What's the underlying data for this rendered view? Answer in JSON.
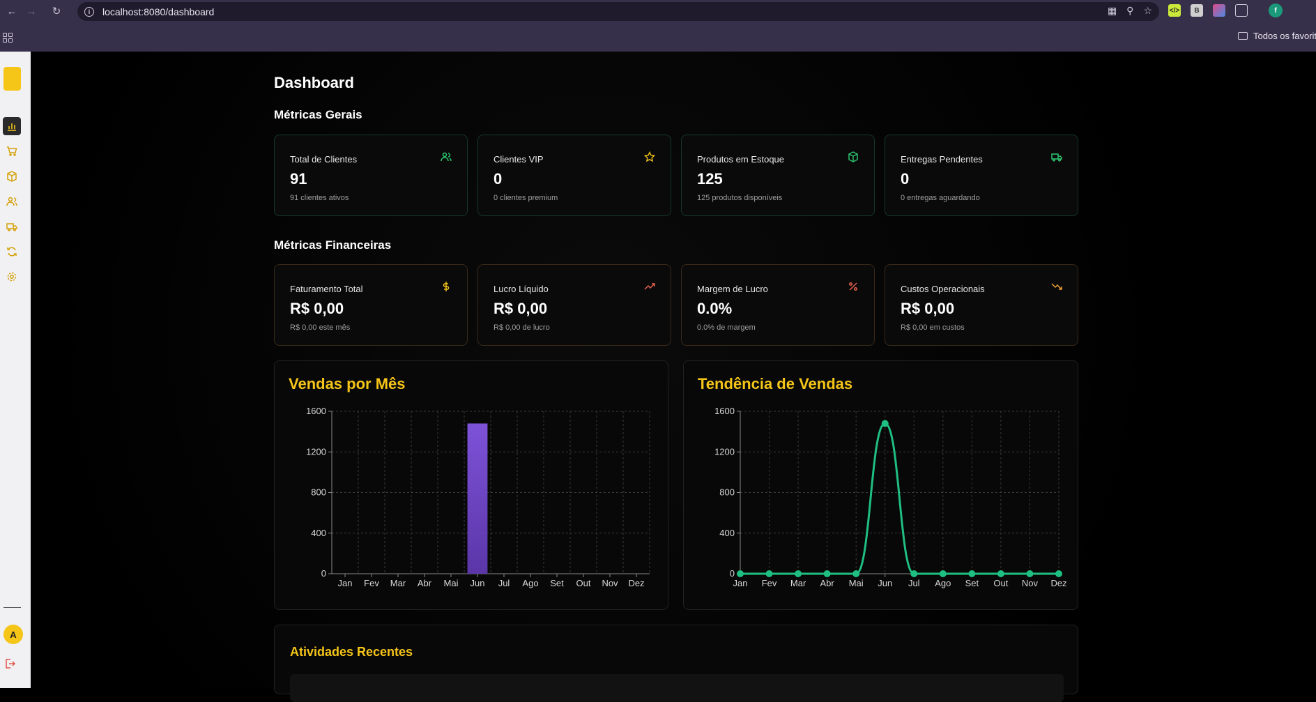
{
  "browser": {
    "url": "localhost:8080/dashboard",
    "bookmarks_label": "Todos os favoritos",
    "profile_initial": "f"
  },
  "sidebar": {
    "items": [
      {
        "name": "dashboard",
        "icon": "bar-chart-icon",
        "active": true
      },
      {
        "name": "sales",
        "icon": "cart-icon",
        "active": false
      },
      {
        "name": "products",
        "icon": "box-icon",
        "active": false
      },
      {
        "name": "clients",
        "icon": "users-icon",
        "active": false
      },
      {
        "name": "deliveries",
        "icon": "truck-icon",
        "active": false
      },
      {
        "name": "sync",
        "icon": "refresh-icon",
        "active": false
      },
      {
        "name": "settings",
        "icon": "gear-icon",
        "active": false
      }
    ],
    "avatar_initial": "A"
  },
  "page": {
    "title": "Dashboard",
    "general_title": "Métricas Gerais",
    "financial_title": "Métricas Financeiras",
    "recent_title": "Atividades Recentes"
  },
  "general_cards": [
    {
      "label": "Total de Clientes",
      "value": "91",
      "sub": "91 clientes ativos",
      "icon": "users-icon"
    },
    {
      "label": "Clientes VIP",
      "value": "0",
      "sub": "0 clientes premium",
      "icon": "star-icon"
    },
    {
      "label": "Produtos em Estoque",
      "value": "125",
      "sub": "125 produtos disponíveis",
      "icon": "box-icon"
    },
    {
      "label": "Entregas Pendentes",
      "value": "0",
      "sub": "0 entregas aguardando",
      "icon": "truck-icon"
    }
  ],
  "financial_cards": [
    {
      "label": "Faturamento Total",
      "value": "R$ 0,00",
      "sub": "R$ 0,00 este mês",
      "icon": "dollar-icon"
    },
    {
      "label": "Lucro Líquido",
      "value": "R$ 0,00",
      "sub": "R$ 0,00 de lucro",
      "icon": "trending-up-icon"
    },
    {
      "label": "Margem de Lucro",
      "value": "0.0%",
      "sub": "0.0% de margem",
      "icon": "percent-icon"
    },
    {
      "label": "Custos Operacionais",
      "value": "R$ 0,00",
      "sub": "R$ 0,00 em custos",
      "icon": "trending-down-icon"
    }
  ],
  "colors": {
    "accent": "#f5c518",
    "bar": "#7b4fd6",
    "line": "#1fbf82",
    "green_icon": "#2ecc71",
    "orange_icon": "#f0a030",
    "red_icon": "#e8604c"
  },
  "chart_data": [
    {
      "type": "bar",
      "title": "Vendas por Mês",
      "categories": [
        "Jan",
        "Fev",
        "Mar",
        "Abr",
        "Mai",
        "Jun",
        "Jul",
        "Ago",
        "Set",
        "Out",
        "Nov",
        "Dez"
      ],
      "values": [
        0,
        0,
        0,
        0,
        0,
        1480,
        0,
        0,
        0,
        0,
        0,
        0
      ],
      "ylim": [
        0,
        1600
      ],
      "yticks": [
        0,
        400,
        800,
        1200,
        1600
      ],
      "grid": true
    },
    {
      "type": "line",
      "title": "Tendência de Vendas",
      "categories": [
        "Jan",
        "Fev",
        "Mar",
        "Abr",
        "Mai",
        "Jun",
        "Jul",
        "Ago",
        "Set",
        "Out",
        "Nov",
        "Dez"
      ],
      "values": [
        0,
        0,
        0,
        0,
        0,
        1480,
        0,
        0,
        0,
        0,
        0,
        0
      ],
      "ylim": [
        0,
        1600
      ],
      "yticks": [
        0,
        400,
        800,
        1200,
        1600
      ],
      "grid": true
    }
  ]
}
